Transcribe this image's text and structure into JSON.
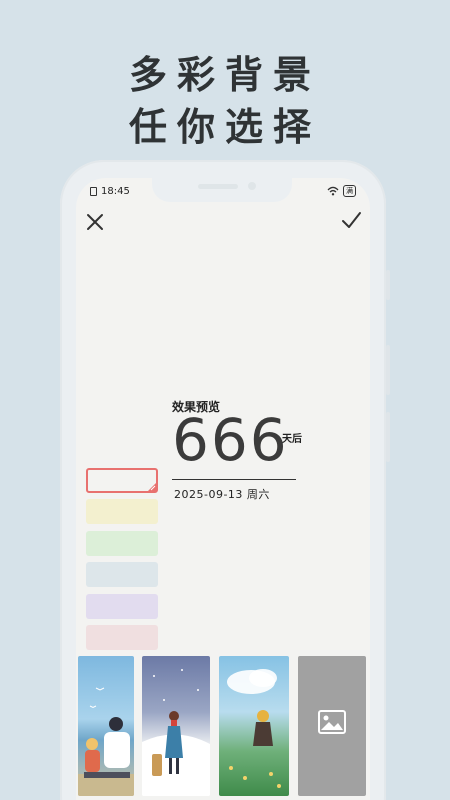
{
  "headline": {
    "line1": "多彩背景",
    "line2": "任你选择"
  },
  "status_bar": {
    "time": "18:45",
    "battery": "满"
  },
  "preview": {
    "label": "效果预览",
    "number": "666",
    "unit": "天后",
    "date": "2025-09-13 周六"
  },
  "swatches": [
    {
      "name": "white",
      "color": "#f3f3f1",
      "selected": true
    },
    {
      "name": "yellow",
      "color": "#f3f0cf"
    },
    {
      "name": "green",
      "color": "#dcefd8"
    },
    {
      "name": "blue",
      "color": "#dde6ea"
    },
    {
      "name": "purple",
      "color": "#e2dcef"
    },
    {
      "name": "pink",
      "color": "#f0dfe0"
    }
  ],
  "backgrounds": [
    "couple-seaside",
    "traveler-snow",
    "girl-field",
    "add-from-gallery"
  ],
  "icons": [
    "close-icon",
    "check-icon",
    "wifi-icon",
    "gallery-icon",
    "pen-icon"
  ],
  "colors": {
    "page_bg": "#d6e2e9",
    "accent": "#e8716f"
  }
}
